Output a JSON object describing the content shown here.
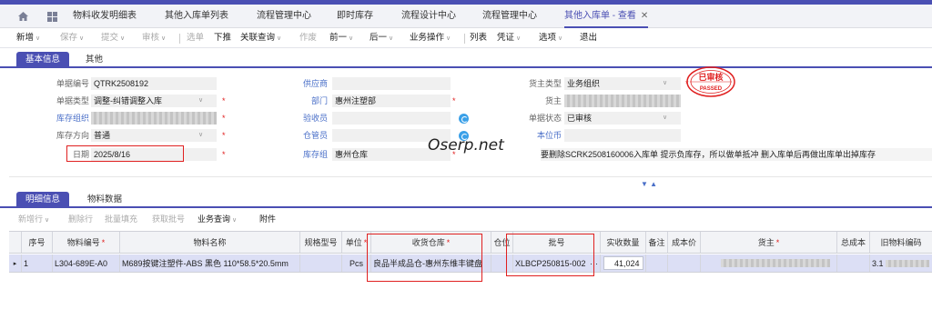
{
  "tabs": {
    "items": [
      {
        "label": "物料收发明细表"
      },
      {
        "label": "其他入库单列表"
      },
      {
        "label": "流程管理中心"
      },
      {
        "label": "即时库存"
      },
      {
        "label": "流程设计中心"
      },
      {
        "label": "流程管理中心"
      },
      {
        "label": "其他入库单 - 查看"
      }
    ],
    "close_glyph": "✕"
  },
  "toolbar": {
    "items": [
      {
        "label": "新增",
        "dd": "∨"
      },
      {
        "label": "保存",
        "dd": "∨"
      },
      {
        "label": "提交",
        "dd": "∨"
      },
      {
        "label": "审核",
        "dd": "∨"
      },
      {
        "label": "选单"
      },
      {
        "label": "下推"
      },
      {
        "label": "关联查询",
        "dd": "∨"
      },
      {
        "label": "作废"
      },
      {
        "label": "前一",
        "dd": "∨"
      },
      {
        "label": "后一",
        "dd": "∨"
      },
      {
        "label": "业务操作",
        "dd": "∨"
      },
      {
        "label": "列表"
      },
      {
        "label": "凭证",
        "dd": "∨"
      },
      {
        "label": "选项",
        "dd": "∨"
      },
      {
        "label": "退出"
      }
    ]
  },
  "info_tabs": [
    "基本信息",
    "其他"
  ],
  "form": {
    "bill_no_label": "单据编号",
    "bill_no": "QTRK2508192",
    "bill_type_label": "单据类型",
    "bill_type": "调整-纠错调整入库",
    "stock_org_label": "库存组织",
    "stock_dir_label": "库存方向",
    "stock_dir": "普通",
    "date_label": "日期",
    "date": "2025/8/16",
    "supplier_label": "供应商",
    "dept_label": "部门",
    "dept": "惠州注塑部",
    "receiver_label": "验收员",
    "keeper_label": "仓管员",
    "stock_group_label": "库存组",
    "stock_group": "惠州仓库",
    "owner_type_label": "货主类型",
    "owner_type": "业务组织",
    "owner_label": "货主",
    "status_label": "单据状态",
    "status": "已审核",
    "currency_label": "本位币",
    "remark_label": "备注",
    "remark": "要删除SCRK2508160006入库单 提示负库存，所以做单抵冲  删入库单后再做出库单出掉库存"
  },
  "stamp": {
    "top": "已审核",
    "bottom": "PASSED"
  },
  "watermark": "Oserp.net",
  "expander_glyph": "▼ ▲",
  "detail_tabs": [
    "明细信息",
    "物料数据"
  ],
  "detail_toolbar": [
    {
      "label": "新增行",
      "dd": "∨",
      "on": false
    },
    {
      "label": "删除行",
      "on": false
    },
    {
      "label": "批量填充",
      "on": false
    },
    {
      "label": "获取批号",
      "on": false
    },
    {
      "label": "业务查询",
      "dd": "∨",
      "on": true
    },
    {
      "label": "附件",
      "on": true
    }
  ],
  "table": {
    "headers": [
      {
        "label": "序号"
      },
      {
        "label": "物料编号",
        "req": true
      },
      {
        "label": "物料名称"
      },
      {
        "label": "规格型号"
      },
      {
        "label": "单位",
        "req": true
      },
      {
        "label": "收货仓库",
        "req": true
      },
      {
        "label": "仓位"
      },
      {
        "label": "批号"
      },
      {
        "label": "实收数量"
      },
      {
        "label": "备注"
      },
      {
        "label": "成本价"
      },
      {
        "label": "货主",
        "req": true
      },
      {
        "label": "总成本"
      },
      {
        "label": "旧物料编码"
      }
    ],
    "rows": [
      {
        "marker": "▸",
        "seq": "1",
        "material_no": "L304-689E-A0",
        "material_name": "M689按键注塑件-ABS 黑色 110*58.5*20.5mm",
        "spec": "",
        "unit": "Pcs",
        "warehouse": "良品半成品仓-惠州东维丰键盘",
        "location": "",
        "batch": "XLBCP250815-002",
        "batch_more": "···",
        "qty": "41,024",
        "note": "",
        "cost": "",
        "total_cost": "",
        "old_code": "3.1"
      }
    ]
  }
}
